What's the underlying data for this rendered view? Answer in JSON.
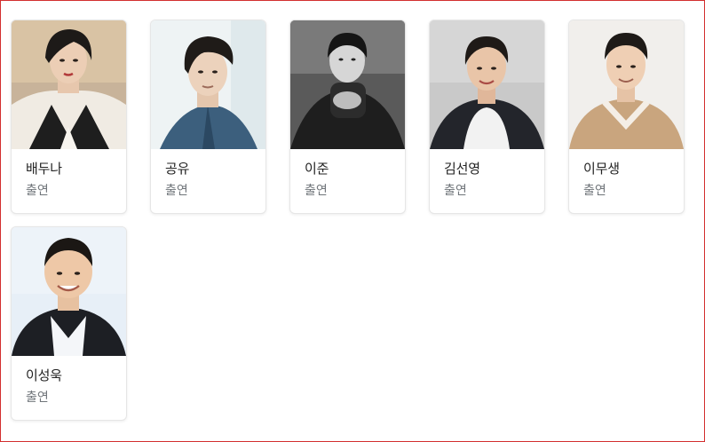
{
  "cast": [
    {
      "name": "배두나",
      "role": "출연"
    },
    {
      "name": "공유",
      "role": "출연"
    },
    {
      "name": "이준",
      "role": "출연"
    },
    {
      "name": "김선영",
      "role": "출연"
    },
    {
      "name": "이무생",
      "role": "출연"
    },
    {
      "name": "이성욱",
      "role": "출연"
    }
  ],
  "colors": {
    "border": "#d32f2f",
    "name_text": "#222222",
    "role_text": "#70757a"
  }
}
